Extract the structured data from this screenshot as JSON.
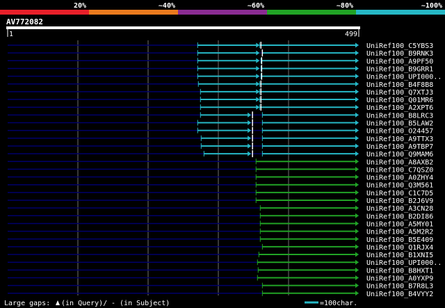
{
  "legend": {
    "segments": [
      {
        "label": "20%",
        "color": "#e8202a"
      },
      {
        "label": "~40%",
        "color": "#ea7a1e"
      },
      {
        "label": "~60%",
        "color": "#8a2c92"
      },
      {
        "label": "~80%",
        "color": "#21a325"
      },
      {
        "label": "~100%",
        "color": "#26b8c6"
      }
    ]
  },
  "query": {
    "name": "AV772082",
    "start_label": "1",
    "end_label": "499",
    "length": 499
  },
  "footer": {
    "gaps_prefix": "Large gaps: ",
    "gaps_query": "(in Query)/",
    "gaps_subject": "- (in Subject)",
    "scale_label": "=100char."
  },
  "colors": {
    "background": "#000000",
    "row_line": "#00006a",
    "ruler": "#ffffff",
    "text": "#ffffff",
    "grid": "#7f7f7f",
    "gap_caret": "#ffffff"
  },
  "chart_data": {
    "type": "alignment",
    "query_length": 499,
    "hits": [
      {
        "name": "UniRef100_C5YBS3",
        "color": "#26b8c6",
        "segments": [
          [
            270,
            358
          ],
          [
            358,
            499
          ]
        ],
        "gap_marks": [
          358
        ]
      },
      {
        "name": "UniRef100_B9RNK3",
        "color": "#26b8c6",
        "segments": [
          [
            270,
            358
          ],
          [
            362,
            499
          ]
        ],
        "gap_marks": [
          360
        ]
      },
      {
        "name": "UniRef100_A9PF50",
        "color": "#26b8c6",
        "segments": [
          [
            270,
            358
          ],
          [
            360,
            499
          ]
        ],
        "gap_marks": [
          359
        ]
      },
      {
        "name": "UniRef100_B9GRR1",
        "color": "#26b8c6",
        "segments": [
          [
            270,
            358
          ],
          [
            360,
            499
          ]
        ],
        "gap_marks": [
          359
        ]
      },
      {
        "name": "UniRef100_UPI000..",
        "color": "#26b8c6",
        "segments": [
          [
            270,
            358
          ],
          [
            360,
            499
          ]
        ],
        "gap_marks": [
          359
        ]
      },
      {
        "name": "UniRef100_B4F8B8",
        "color": "#26b8c6",
        "segments": [
          [
            271,
            358
          ],
          [
            358,
            499
          ]
        ],
        "gap_marks": [
          358
        ]
      },
      {
        "name": "UniRef100_Q7XTJ3",
        "color": "#26b8c6",
        "segments": [
          [
            274,
            358
          ],
          [
            358,
            499
          ]
        ],
        "gap_marks": [
          358
        ]
      },
      {
        "name": "UniRef100_Q01MR6",
        "color": "#26b8c6",
        "segments": [
          [
            274,
            358
          ],
          [
            358,
            499
          ]
        ],
        "gap_marks": [
          358
        ]
      },
      {
        "name": "UniRef100_A2XPT6",
        "color": "#26b8c6",
        "segments": [
          [
            274,
            358
          ],
          [
            358,
            499
          ]
        ],
        "gap_marks": [
          358
        ]
      },
      {
        "name": "UniRef100_B8LRC3",
        "color": "#26b8c6",
        "segments": [
          [
            274,
            346
          ],
          [
            362,
            499
          ]
        ],
        "gap_marks": [
          346
        ]
      },
      {
        "name": "UniRef100_B5LAW2",
        "color": "#26b8c6",
        "segments": [
          [
            270,
            346
          ],
          [
            362,
            499
          ]
        ],
        "gap_marks": [
          346
        ]
      },
      {
        "name": "UniRef100_O24457",
        "color": "#26b8c6",
        "segments": [
          [
            270,
            346
          ],
          [
            362,
            499
          ]
        ],
        "gap_marks": [
          346
        ]
      },
      {
        "name": "UniRef100_A9TTX3",
        "color": "#26b8c6",
        "segments": [
          [
            275,
            346
          ],
          [
            362,
            499
          ]
        ],
        "gap_marks": [
          346
        ]
      },
      {
        "name": "UniRef100_A9TBP7",
        "color": "#26b8c6",
        "segments": [
          [
            275,
            346
          ],
          [
            362,
            499
          ]
        ],
        "gap_marks": [
          346
        ]
      },
      {
        "name": "UniRef100_Q9MAM6",
        "color": "#26b8c6",
        "segments": [
          [
            279,
            346
          ],
          [
            362,
            499
          ]
        ],
        "gap_marks": [
          346
        ]
      },
      {
        "name": "UniRef100_A8AXB2",
        "color": "#21a325",
        "segments": [
          [
            353,
            499
          ]
        ],
        "gap_marks": []
      },
      {
        "name": "UniRef100_C7QSZ0",
        "color": "#21a325",
        "segments": [
          [
            353,
            499
          ]
        ],
        "gap_marks": []
      },
      {
        "name": "UniRef100_A0ZHY4",
        "color": "#21a325",
        "segments": [
          [
            353,
            499
          ]
        ],
        "gap_marks": []
      },
      {
        "name": "UniRef100_Q3M561",
        "color": "#21a325",
        "segments": [
          [
            353,
            499
          ]
        ],
        "gap_marks": []
      },
      {
        "name": "UniRef100_C1C7D5",
        "color": "#21a325",
        "segments": [
          [
            353,
            499
          ]
        ],
        "gap_marks": []
      },
      {
        "name": "UniRef100_B2J6V9",
        "color": "#21a325",
        "segments": [
          [
            353,
            499
          ]
        ],
        "gap_marks": []
      },
      {
        "name": "UniRef100_A3CN28",
        "color": "#21a325",
        "segments": [
          [
            359,
            499
          ]
        ],
        "gap_marks": []
      },
      {
        "name": "UniRef100_B2DI86",
        "color": "#21a325",
        "segments": [
          [
            359,
            499
          ]
        ],
        "gap_marks": []
      },
      {
        "name": "UniRef100_A5MY01",
        "color": "#21a325",
        "segments": [
          [
            359,
            499
          ]
        ],
        "gap_marks": []
      },
      {
        "name": "UniRef100_A5M2R2",
        "color": "#21a325",
        "segments": [
          [
            359,
            499
          ]
        ],
        "gap_marks": []
      },
      {
        "name": "UniRef100_B5E409",
        "color": "#21a325",
        "segments": [
          [
            359,
            499
          ]
        ],
        "gap_marks": []
      },
      {
        "name": "UniRef100_Q1RJX4",
        "color": "#21a325",
        "segments": [
          [
            362,
            499
          ]
        ],
        "gap_marks": []
      },
      {
        "name": "UniRef100_B1XNI5",
        "color": "#21a325",
        "segments": [
          [
            357,
            499
          ]
        ],
        "gap_marks": []
      },
      {
        "name": "UniRef100_UPI000..",
        "color": "#21a325",
        "segments": [
          [
            355,
            499
          ]
        ],
        "gap_marks": []
      },
      {
        "name": "UniRef100_B8HXT1",
        "color": "#21a325",
        "segments": [
          [
            356,
            499
          ]
        ],
        "gap_marks": []
      },
      {
        "name": "UniRef100_A0YXP9",
        "color": "#21a325",
        "segments": [
          [
            355,
            499
          ]
        ],
        "gap_marks": []
      },
      {
        "name": "UniRef100_B7R8L3",
        "color": "#21a325",
        "segments": [
          [
            362,
            499
          ]
        ],
        "gap_marks": []
      },
      {
        "name": "UniRef100_B4VYY2",
        "color": "#21a325",
        "segments": [
          [
            362,
            499
          ]
        ],
        "gap_marks": []
      }
    ]
  }
}
